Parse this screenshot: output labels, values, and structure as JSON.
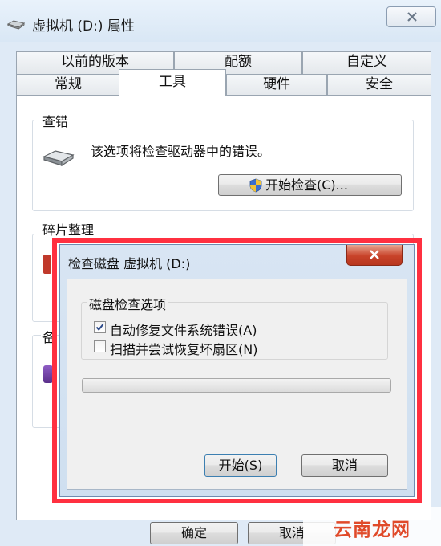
{
  "window": {
    "title": "虚拟机 (D:) 属性"
  },
  "tabs": {
    "row1": [
      "以前的版本",
      "配额",
      "自定义"
    ],
    "row2": [
      "常规",
      "工具",
      "硬件",
      "安全"
    ],
    "active": "工具"
  },
  "error_check": {
    "title": "查错",
    "description": "该选项将检查驱动器中的错误。",
    "button_label": "开始检查(C)..."
  },
  "defrag": {
    "title": "碎片整理"
  },
  "backup": {
    "title_fragment": "备"
  },
  "footer": {
    "ok_label": "确定",
    "cancel_label": "取消"
  },
  "dialog": {
    "title": "检查磁盘 虚拟机 (D:)",
    "group_title": "磁盘检查选项",
    "options": [
      {
        "label": "自动修复文件系统错误(A)",
        "checked": true
      },
      {
        "label": "扫描并尝试恢复坏扇区(N)",
        "checked": false
      }
    ],
    "start_label": "开始(S)",
    "cancel_label": "取消"
  },
  "watermark": {
    "text": "云南龙网"
  },
  "colors": {
    "highlight_border": "#ff3040",
    "window_bg": "#dfeaf6"
  }
}
